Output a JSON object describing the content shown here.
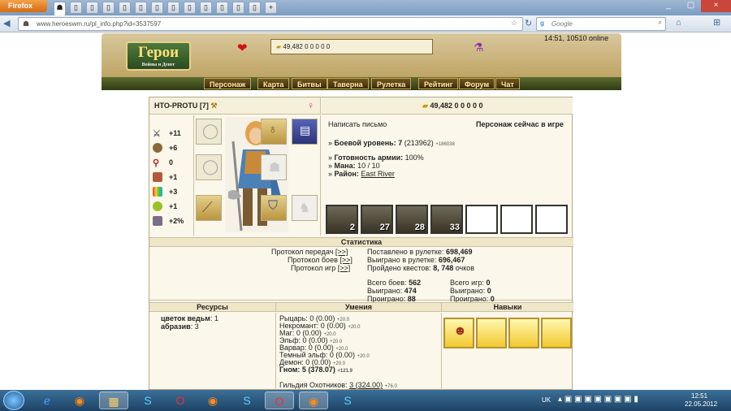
{
  "browser": {
    "menu_label": "Firefox",
    "url": "www.heroeswm.ru/pl_info.php?id=3537597",
    "search_placeholder": "Google",
    "new_tab": "+",
    "close": "×",
    "minimize": "_"
  },
  "site": {
    "logo_main": "Герои",
    "logo_sub": "Войны и Денег",
    "top_resources": "49,482 0 0 0 0 0",
    "clock": "14:51, 10510 online",
    "menu": [
      "Персонаж",
      "Карта",
      "Битвы",
      "Таверна",
      "Рулетка",
      "Рейтинг",
      "Форум",
      "Чат"
    ]
  },
  "profile": {
    "name": "HTO-PROTU",
    "level": "[7]",
    "gender_symbol": "♀",
    "resources_line": "49,482 0 0 0 0 0",
    "stats": [
      "+11",
      "+6",
      "0",
      "+1",
      "+3",
      "+1",
      "+2%"
    ],
    "write_letter": "Написать письмо",
    "online_status": "Персонаж сейчас в игре",
    "combat_level_label": "Боевой уровень:",
    "combat_level_value": "7",
    "combat_level_exp": "(213962)",
    "combat_level_small": "+186038",
    "army_ready_label": "Готовность армии:",
    "army_ready_value": "100%",
    "mana_label": "Мана:",
    "mana_value": "10 / 10",
    "district_label": "Район:",
    "district_value": "East River",
    "army_counts": [
      "2",
      "27",
      "28",
      "33"
    ]
  },
  "statistics": {
    "header": "Статистика",
    "protocols": [
      "Протокол передач",
      "Протокол боев",
      "Протокол игр"
    ],
    "protocol_link": "[>>]",
    "roulette_bet": "Поставлено в рулетке:",
    "roulette_bet_value": "698,469",
    "roulette_won": "Выиграно в рулетке:",
    "roulette_won_value": "696,467",
    "quests": "Пройдено квестов:",
    "quests_value": "8, 748",
    "quests_suffix": "очков",
    "battles_total": "Всего боев:",
    "battles_total_value": "562",
    "battles_won": "Выиграно:",
    "battles_won_value": "474",
    "battles_lost": "Проиграно:",
    "battles_lost_value": "88",
    "games_total": "Всего игр:",
    "games_total_value": "0",
    "games_won": "Выиграно:",
    "games_won_value": "0",
    "games_lost": "Проиграно:",
    "games_lost_value": "0"
  },
  "resources": {
    "header": "Ресурсы",
    "items": [
      {
        "name": "цветок ведьм",
        "value": "1"
      },
      {
        "name": "абразив",
        "value": "3"
      }
    ]
  },
  "skills": {
    "header": "Умения",
    "items": [
      {
        "name": "Рыцарь:",
        "value": "0 (0.00)",
        "small": "+20.0"
      },
      {
        "name": "Некромант:",
        "value": "0 (0.00)",
        "small": "+20.0"
      },
      {
        "name": "Маг:",
        "value": "0 (0.00)",
        "small": "+20.0"
      },
      {
        "name": "Эльф:",
        "value": "0 (0.00)",
        "small": "+20.0"
      },
      {
        "name": "Варвар:",
        "value": "0 (0.00)",
        "small": "+20.0"
      },
      {
        "name": "Темный эльф:",
        "value": "0 (0.00)",
        "small": "+20.0"
      },
      {
        "name": "Демон:",
        "value": "0 (0.00)",
        "small": "+20.0"
      },
      {
        "name": "Гном:",
        "value": "5 (378.07)",
        "small": "+121.9"
      }
    ],
    "guild": "Гильдия Охотников:",
    "guild_value": "3 (324.00)",
    "guild_small": "+76.0"
  },
  "abilities": {
    "header": "Навыки"
  },
  "taskbar": {
    "lang": "UK",
    "time": "12:51",
    "date": "22.05.2012"
  },
  "colors": {
    "accent": "#b8902c",
    "menu_text": "#ffe6a0",
    "gender": "#d630a8"
  }
}
